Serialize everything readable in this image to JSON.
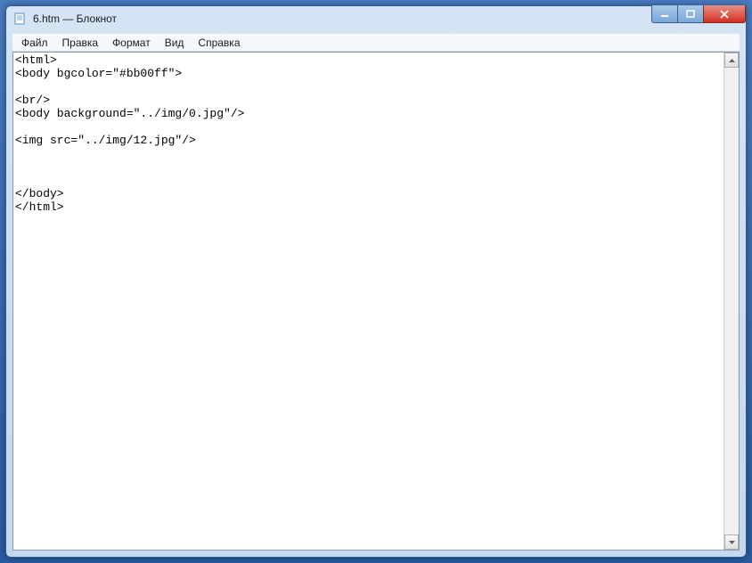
{
  "window": {
    "title": "6.htm — Блокнот"
  },
  "menubar": {
    "items": [
      {
        "label": "Файл"
      },
      {
        "label": "Правка"
      },
      {
        "label": "Формат"
      },
      {
        "label": "Вид"
      },
      {
        "label": "Справка"
      }
    ]
  },
  "editor": {
    "content": "<html>\n<body bgcolor=\"#bb00ff\">\n\n<br/>\n<body background=\"../img/0.jpg\"/>\n\n<img src=\"../img/12.jpg\"/>\n\n\n\n</body>\n</html>"
  }
}
